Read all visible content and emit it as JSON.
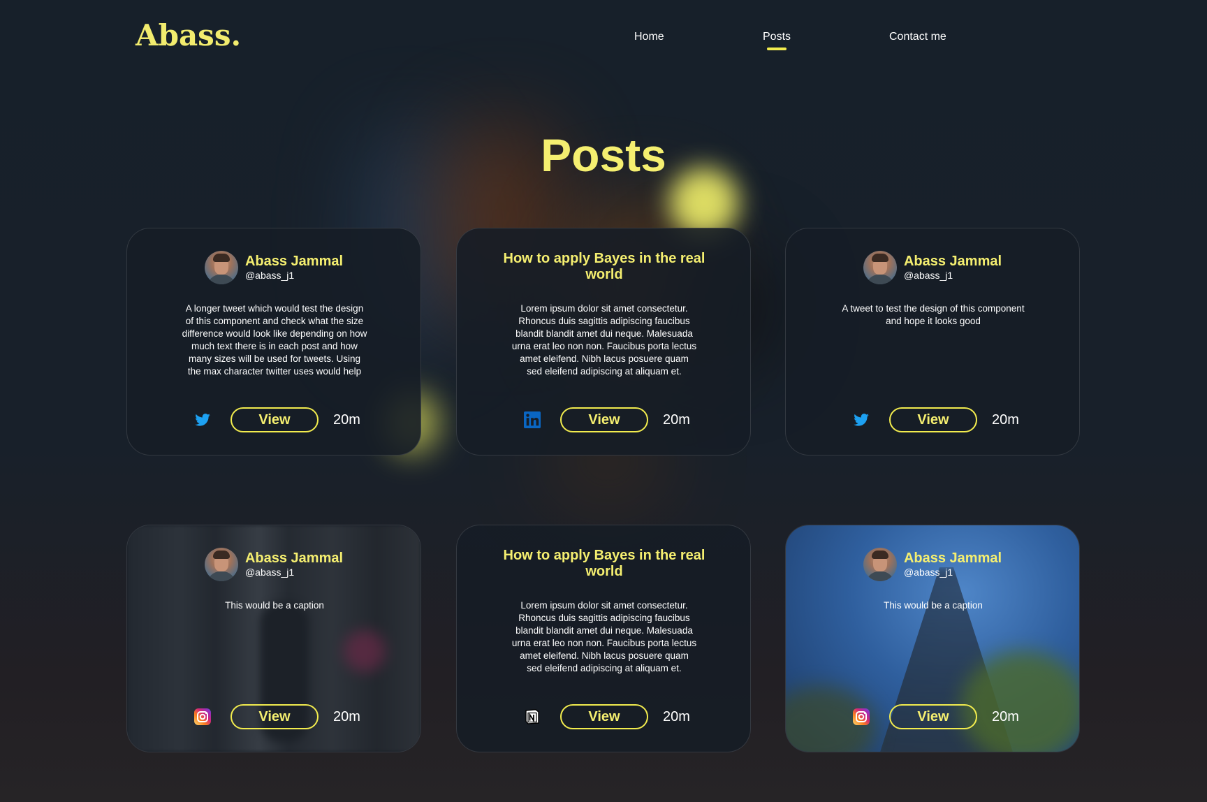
{
  "brand": {
    "logo": "Abass."
  },
  "nav": {
    "items": [
      {
        "label": "Home"
      },
      {
        "label": "Posts"
      },
      {
        "label": "Contact me"
      }
    ],
    "active": "Posts"
  },
  "page": {
    "title": "Posts"
  },
  "colors": {
    "accent": "#f5ef70",
    "card_bg": "#161d26",
    "twitter": "#1da1f2",
    "linkedin": "#0a66c2"
  },
  "posts": [
    {
      "kind": "tweet",
      "author": "Abass Jammal",
      "handle": "@abass_j1",
      "text": "A longer tweet which would test the design of this component and check what the size difference would look like depending on how much text there is in each post and how many sizes will be used for tweets. Using the max character twitter uses would help",
      "source_icon": "twitter-icon",
      "view_label": "View",
      "time": "20m"
    },
    {
      "kind": "article",
      "title": "How to apply Bayes in the real world",
      "text": "Lorem ipsum dolor sit amet consectetur. Rhoncus duis sagittis adipiscing faucibus blandit blandit amet dui neque. Malesuada urna erat leo non non. Faucibus porta lectus amet eleifend. Nibh lacus posuere quam sed eleifend adipiscing at aliquam et.",
      "source_icon": "linkedin-icon",
      "view_label": "View",
      "time": "20m"
    },
    {
      "kind": "tweet",
      "author": "Abass Jammal",
      "handle": "@abass_j1",
      "text": "A tweet to test the design of this component and hope it looks good",
      "source_icon": "twitter-icon",
      "view_label": "View",
      "time": "20m"
    },
    {
      "kind": "instagram",
      "author": "Abass Jammal",
      "handle": "@abass_j1",
      "text": "This would be a caption",
      "source_icon": "instagram-icon",
      "view_label": "View",
      "time": "20m"
    },
    {
      "kind": "article",
      "title": "How to apply Bayes in the real world",
      "text": "Lorem ipsum dolor sit amet consectetur. Rhoncus duis sagittis adipiscing faucibus blandit blandit amet dui neque. Malesuada urna erat leo non non. Faucibus porta lectus amet eleifend. Nibh lacus posuere quam sed eleifend adipiscing at aliquam et.",
      "source_icon": "notion-icon",
      "view_label": "View",
      "time": "20m"
    },
    {
      "kind": "instagram",
      "author": "Abass Jammal",
      "handle": "@abass_j1",
      "text": "This would be a caption",
      "source_icon": "instagram-icon",
      "view_label": "View",
      "time": "20m"
    }
  ]
}
